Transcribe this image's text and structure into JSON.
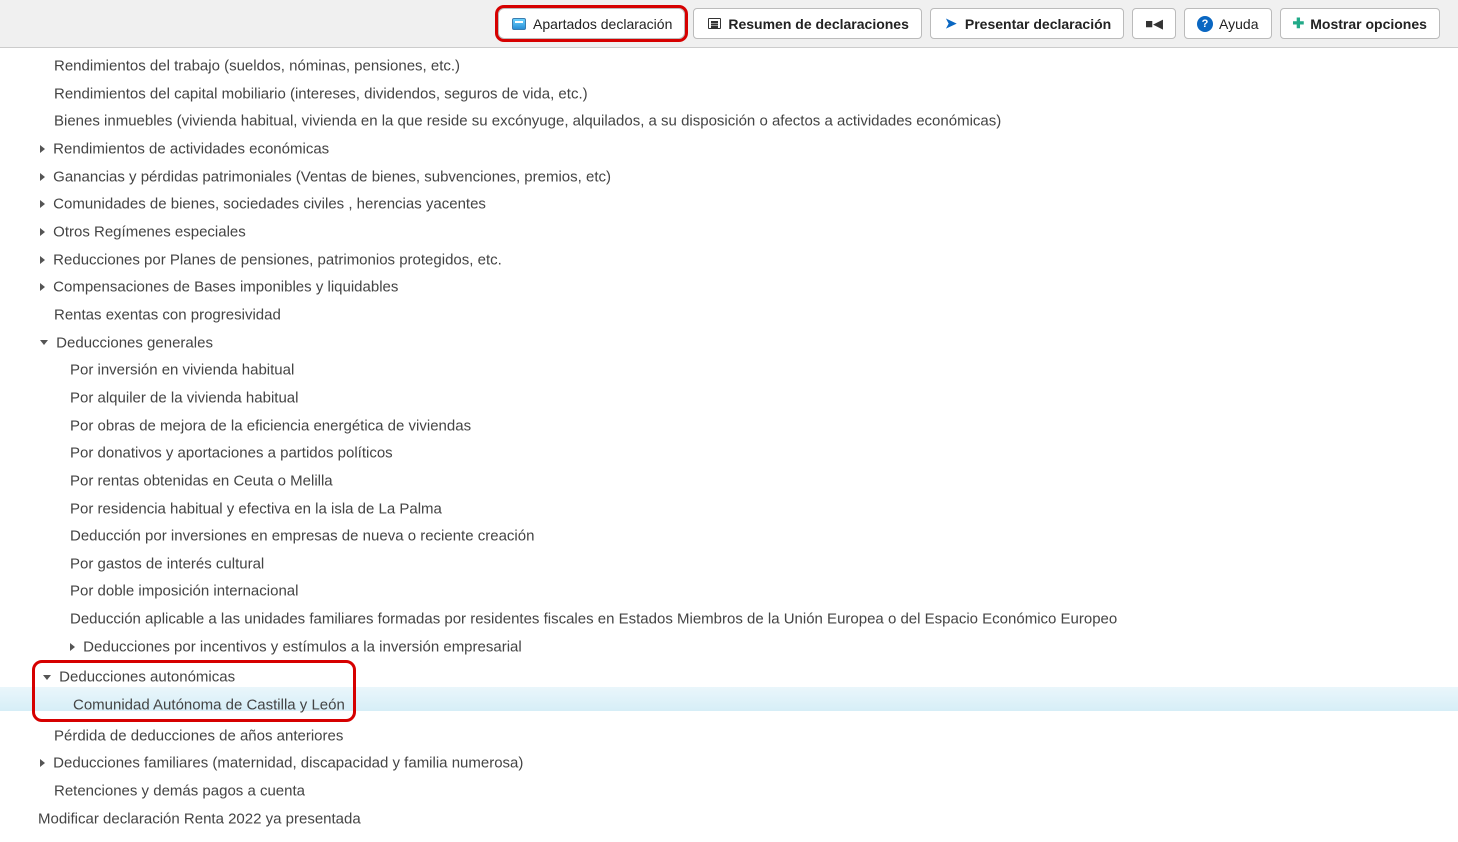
{
  "toolbar": {
    "apartados": "Apartados declaración",
    "resumen": "Resumen de declaraciones",
    "presentar": "Presentar declaración",
    "ayuda": "Ayuda",
    "mostrar_opciones": "Mostrar opciones"
  },
  "tree": {
    "rend_trabajo": "Rendimientos del trabajo (sueldos, nóminas, pensiones, etc.)",
    "rend_capital": "Rendimientos del capital mobiliario (intereses, dividendos, seguros de vida, etc.)",
    "bienes_inmuebles": "Bienes inmuebles (vivienda habitual, vivienda en la que reside su excónyuge, alquilados, a su disposición o afectos a actividades económicas)",
    "rend_actividades": "Rendimientos de actividades económicas",
    "ganancias_perdidas": "Ganancias y pérdidas patrimoniales (Ventas de bienes, subvenciones, premios, etc)",
    "comunidades_bienes": "Comunidades de bienes, sociedades civiles , herencias yacentes",
    "otros_regimenes": "Otros Regímenes especiales",
    "reducciones_planes": "Reducciones por Planes de pensiones, patrimonios protegidos, etc.",
    "compensaciones_bases": "Compensaciones de Bases imponibles y liquidables",
    "rentas_exentas": "Rentas exentas con progresividad",
    "deducciones_generales": "Deducciones generales",
    "dg_inversion_vivienda": "Por inversión en vivienda habitual",
    "dg_alquiler_vivienda": "Por alquiler de la vivienda habitual",
    "dg_obras_mejora": "Por obras de mejora de la eficiencia energética de viviendas",
    "dg_donativos": "Por donativos y aportaciones a partidos políticos",
    "dg_rentas_ceuta": "Por rentas obtenidas en Ceuta o Melilla",
    "dg_residencia_palma": "Por residencia habitual y efectiva en la isla de La Palma",
    "dg_inversion_empresas": "Deducción por inversiones en empresas de nueva o reciente creación",
    "dg_gastos_cultural": "Por gastos de interés cultural",
    "dg_doble_imposicion": "Por doble imposición internacional",
    "dg_unidades_familiares": "Deducción aplicable a las unidades familiares formadas por residentes fiscales en Estados Miembros de la Unión Europea o del Espacio Económico Europeo",
    "dg_incentivos": "Deducciones por incentivos y estímulos a la inversión empresarial",
    "deducciones_autonomicas": "Deducciones autonómicas",
    "da_castilla_leon": "Comunidad Autónoma de Castilla y León",
    "perdida_deducciones": "Pérdida de deducciones de años anteriores",
    "deducciones_familiares": "Deducciones familiares (maternidad, discapacidad y familia numerosa)",
    "retenciones": "Retenciones y demás pagos a cuenta",
    "modificar_declaracion": "Modificar declaración Renta 2022 ya presentada"
  }
}
